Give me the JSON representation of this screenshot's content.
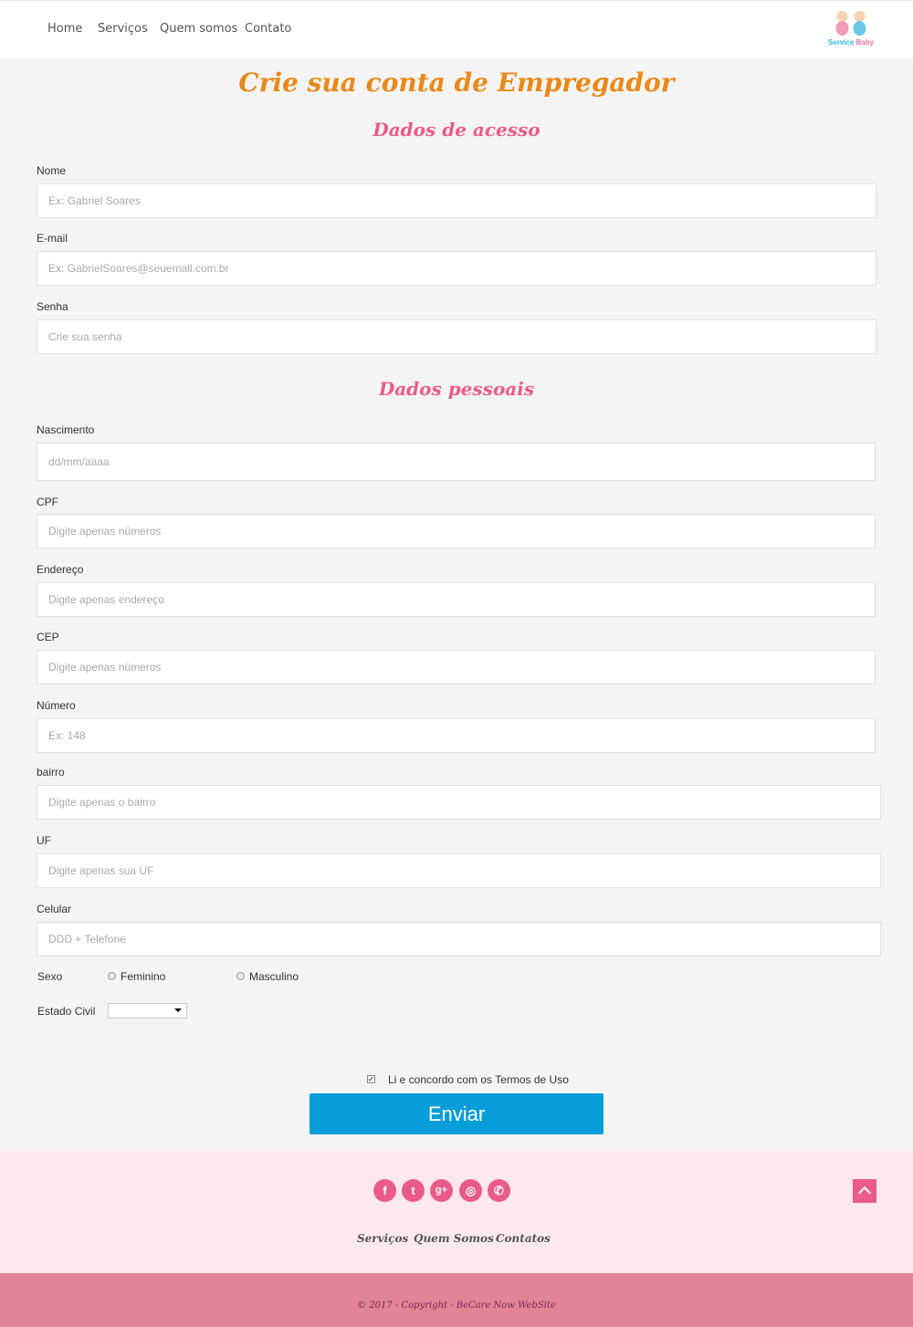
{
  "nav": {
    "home": "Home",
    "servicos": "Serviços",
    "quem_somos": "Quem somos",
    "contato": "Contato"
  },
  "logo": {
    "word1": "Service",
    "word2": "Baby"
  },
  "page_title": "Crie sua conta de Empregador",
  "section_access": "Dados de acesso",
  "section_personal": "Dados pessoais",
  "fields": {
    "nome": {
      "label": "Nome",
      "placeholder": "Ex: Gabriel Soares"
    },
    "email": {
      "label": "E-mail",
      "placeholder": "Ex: GabrielSoares@seuemail.com.br"
    },
    "senha": {
      "label": "Senha",
      "placeholder": "Crie sua senha"
    },
    "nascimento": {
      "label": "Nascimento",
      "placeholder": "dd/mm/aaaa"
    },
    "cpf": {
      "label": "CPF",
      "placeholder": "Digite apenas números"
    },
    "endereco": {
      "label": "Endereço",
      "placeholder": "Digite apenas endereço"
    },
    "cep": {
      "label": "CEP",
      "placeholder": "Digite apenas números"
    },
    "numero": {
      "label": "Número",
      "placeholder": "Ex: 148"
    },
    "bairro": {
      "label": "bairro",
      "placeholder": "Digite apenas o bairro"
    },
    "uf": {
      "label": "UF",
      "placeholder": "Digite apenas sua UF"
    },
    "celular": {
      "label": "Celular",
      "placeholder": "DDD + Telefone"
    }
  },
  "sexo": {
    "label": "Sexo",
    "opt1": "Feminino",
    "opt2": "Masculino"
  },
  "estado_civil": {
    "label": "Estado Civil",
    "value": ""
  },
  "terms": {
    "label": "Li e concordo com os Termos de Uso",
    "checked": true
  },
  "submit": "Enviar",
  "social": [
    "facebook-icon",
    "twitter-icon",
    "google-plus-icon",
    "instagram-icon",
    "whatsapp-icon"
  ],
  "social_glyphs": {
    "facebook": "f",
    "twitter": "t",
    "google": "g+",
    "instagram": "◎",
    "whatsapp": "✆"
  },
  "footer_links": {
    "servicos": "Serviços",
    "quem_somos": "Quem Somos",
    "contatos": "Contatos"
  },
  "copyright": "© 2017 - Copyright - BeCare Now WebSite",
  "colors": {
    "title": "#e8891a",
    "section": "#ea5b88",
    "button": "#079dd8",
    "footer_bg": "#fde9ec",
    "bottom_bar": "#e0839b"
  }
}
